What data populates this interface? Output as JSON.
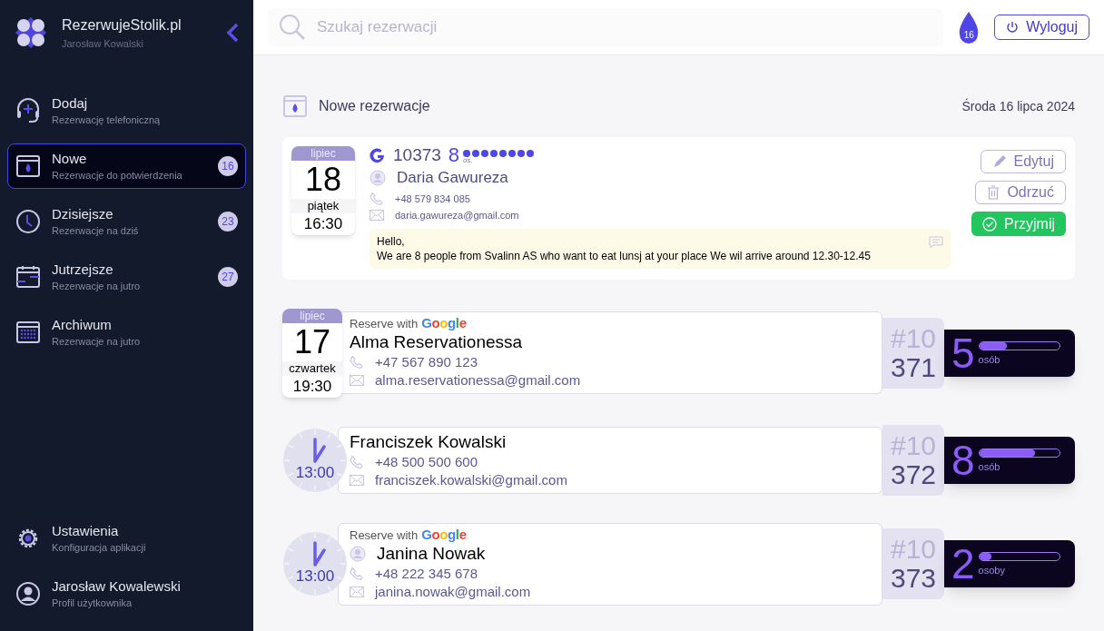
{
  "sidebar": {
    "brand": "RezerwujeStolik.pl",
    "user": "Jarosław Kowalski",
    "items": [
      {
        "kind": "add",
        "title": "Dodaj",
        "subtitle": "Rezerwację telefoniczną",
        "selected": false
      },
      {
        "kind": "new",
        "title": "Nowe",
        "subtitle": "Rezerwacje do potwierdzenia",
        "badge": "16",
        "selected": true
      },
      {
        "kind": "today",
        "title": "Dzisiejsze",
        "subtitle": "Rezerwacje na dziś",
        "badge": "23",
        "selected": false
      },
      {
        "kind": "tomorrow",
        "title": "Jutrzejsze",
        "subtitle": "Rezerwacje na jutro",
        "badge": "27",
        "selected": false
      },
      {
        "kind": "archive",
        "title": "Archiwum",
        "subtitle": "Rezerwacje na jutro",
        "selected": false
      }
    ],
    "bottom_items": [
      {
        "kind": "settings",
        "title": "Ustawienia",
        "subtitle": "Konfiguracja aplikacji"
      },
      {
        "kind": "profile",
        "title": "Jarosław Kowalewski",
        "subtitle": "Profil użytkownika"
      }
    ]
  },
  "topbar": {
    "search_placeholder": "Szukaj rezerwacji",
    "notification_count": "16",
    "logout": "Wyloguj"
  },
  "section": {
    "title": "Nowe rezerwacje",
    "date": "Środa 16 lipca 2024"
  },
  "featured": {
    "month": "lipiec",
    "day": "18",
    "weekday": "piątek",
    "time": "16:30",
    "number": "10373",
    "guests": "8",
    "guests_unit": "os.",
    "stars": 8,
    "name": "Daria Gawureza",
    "phone": "+48 579 834 085",
    "email": "daria.gawureza@gmail.com",
    "message": [
      "Hello,",
      "We are 8 people from Svalinn AS who want to eat lunsj at your place We wil arrive around 12.30-12.45"
    ],
    "actions": [
      {
        "kind": "edit",
        "label": "Edytuj"
      },
      {
        "kind": "reject",
        "label": "Odrzuć"
      },
      {
        "kind": "accept",
        "label": "Przyjmij"
      }
    ]
  },
  "reservations": [
    {
      "kind": "calendar",
      "month": "lipiec",
      "day": "17",
      "weekday": "czwartek",
      "time": "19:30",
      "source": "Reserve with",
      "source_brand": "Google",
      "person_icon": false,
      "name": "Alma Reservationessa",
      "phone": "+47 567 890 123",
      "email": "alma.reservationessa@gmail.com",
      "number_prefix": "#10",
      "number": "371",
      "guests": "5",
      "guests_unit": "osób",
      "level": 0.35
    },
    {
      "kind": "clock",
      "time": "13:00",
      "person_icon": false,
      "name": "Franciszek Kowalski",
      "phone": "+48 500 500 600",
      "email": "franciszek.kowalski@gmail.com",
      "number_prefix": "#10",
      "number": "372",
      "guests": "8",
      "guests_unit": "osób",
      "level": 0.7
    },
    {
      "kind": "clock",
      "time": "13:00",
      "source": "Reserve with",
      "source_brand": "Google",
      "person_icon": true,
      "name": "Janina Nowak",
      "phone": "+48 222 345 678",
      "email": "janina.nowak@gmail.com",
      "number_prefix": "#10",
      "number": "373",
      "guests": "2",
      "guests_unit": "osoby",
      "level": 0.15
    }
  ]
}
